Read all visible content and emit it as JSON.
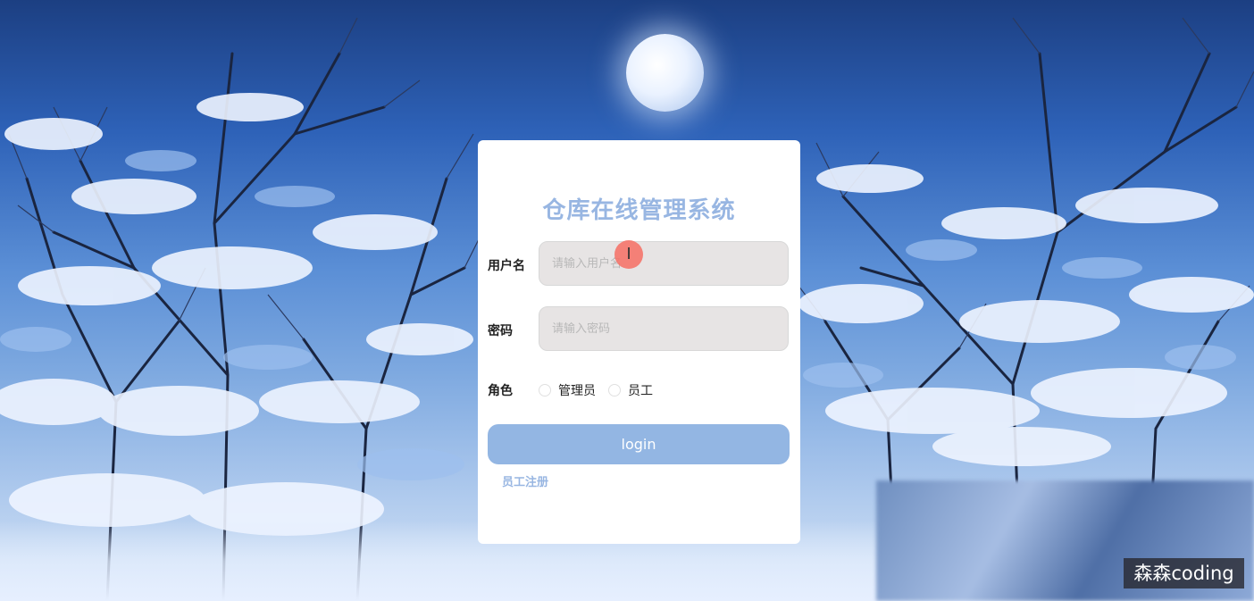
{
  "login": {
    "title": "仓库在线管理系统",
    "username_label": "用户名",
    "username_placeholder": "请输入用户名",
    "password_label": "密码",
    "password_placeholder": "请输入密码",
    "role_label": "角色",
    "role_options": [
      "管理员",
      "员工"
    ],
    "login_button": "login",
    "register_link": "员工注册"
  },
  "watermark": {
    "text": "森森coding"
  },
  "colors": {
    "accent": "#93b6e3",
    "title": "#98b6e2",
    "input_bg": "#e7e4e4"
  }
}
